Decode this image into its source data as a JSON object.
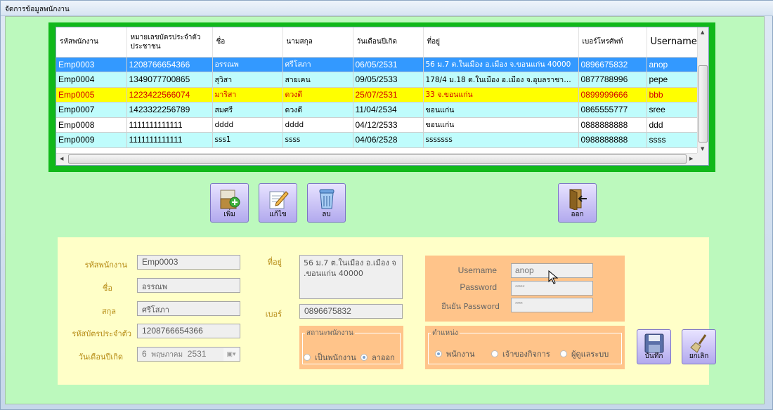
{
  "window": {
    "title": "จัดการข้อมูลพนักงาน"
  },
  "grid": {
    "columns": [
      "รหัสพนักงาน",
      "หมายเลขบัตรประจำตัวประชาชน",
      "ชื่อ",
      "นามสกุล",
      "วันเดือนปีเกิด",
      "ที่อยู่",
      "เบอร์โทรศัพท์",
      "Username"
    ],
    "rows": [
      {
        "id": "Emp0003",
        "card": "1208766654366",
        "first": "อรรณพ",
        "last": "ศรีโสภา",
        "dob": "06/05/2531",
        "addr": "56 ม.7 ต.ในเมือง อ.เมือง จ.ขอนแก่น 40000",
        "phone": "0896675832",
        "user": "anop",
        "style": "sel"
      },
      {
        "id": "Emp0004",
        "card": "1349077700865",
        "first": "สุวิสา",
        "last": "สายเคน",
        "dob": "09/05/2533",
        "addr": "178/4 ม.18 ต.ในเมือง อ.เมือง จ.อุบลราชานี 5...",
        "phone": "0877788996",
        "user": "pepe",
        "style": "cyan"
      },
      {
        "id": "Emp0005",
        "card": "1223422566074",
        "first": "มาริสา",
        "last": "ดวงดี",
        "dob": "25/07/2531",
        "addr": "33 จ.ขอนแก่น",
        "phone": "0899999666",
        "user": "bbb",
        "style": "yel"
      },
      {
        "id": "Emp0007",
        "card": "1423322256789",
        "first": "สมศรี",
        "last": "ดวงดี",
        "dob": "11/04/2534",
        "addr": "ขอนแก่น",
        "phone": "0865555777",
        "user": "sree",
        "style": "cyan"
      },
      {
        "id": "Emp0008",
        "card": "1111111111111",
        "first": "dddd",
        "last": "dddd",
        "dob": "04/12/2533",
        "addr": "ขอนแก่น",
        "phone": "0888888888",
        "user": "ddd",
        "style": "white"
      },
      {
        "id": "Emp0009",
        "card": "1111111111111",
        "first": "sss1",
        "last": "ssss",
        "dob": "04/06/2528",
        "addr": "sssssss",
        "phone": "0988888888",
        "user": "ssss",
        "style": "cyan"
      }
    ]
  },
  "toolbar": {
    "add_label": "เพิ่ม",
    "edit_label": "แก้ไข",
    "delete_label": "ลบ",
    "exit_label": "ออก"
  },
  "form": {
    "emp_id_label": "รหัสพนักงาน",
    "emp_id": "Emp0003",
    "name_label": "ชื่อ",
    "name": "อรรณพ",
    "surname_label": "สกุล",
    "surname": "ศรีโสภา",
    "card_label": "รหัสบัตรประจำตัว",
    "card": "1208766654366",
    "dob_label": "วันเดือนปีเกิด",
    "dob_day": "6",
    "dob_month": "พฤษภาคม",
    "dob_year": "2531",
    "address_label": "ที่อยู่",
    "address_line1": "56 ม.7 ต.ในเมือง อ.เมือง จ",
    "address_line2": ".ขอนแก่น 40000",
    "phone_label": "เบอร์",
    "phone": "0896675832",
    "status_legend": "สถานะพนักงาน",
    "status_active": "เป็นพนักงาน",
    "status_left": "ลาออก",
    "position_legend": "ตำแหน่ง",
    "pos_employee": "พนักงาน",
    "pos_owner": "เจ้าของกิจการ",
    "pos_admin": "ผู้ดูแลระบบ"
  },
  "credentials": {
    "username_label": "Username",
    "username": "anop",
    "password_label": "Password",
    "password": "*****",
    "confirm_label": "ยืนยัน Password",
    "confirm": "****"
  },
  "actions": {
    "save_label": "บันทึก",
    "cancel_label": "ยกเลิก"
  }
}
